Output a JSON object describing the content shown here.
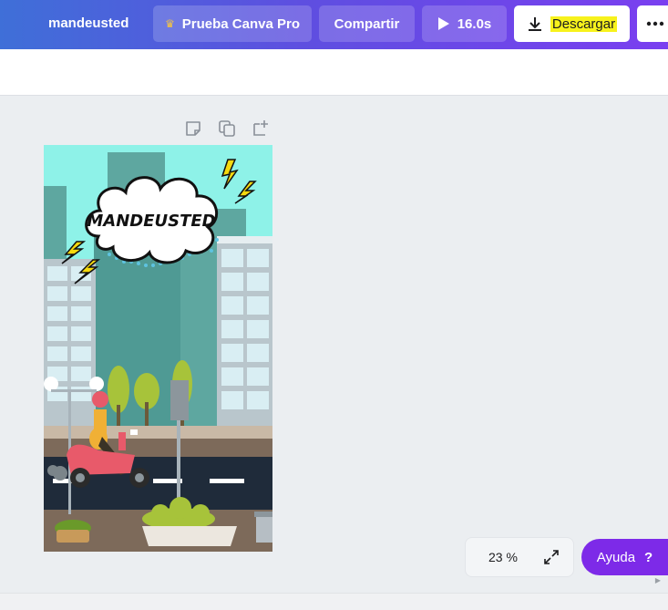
{
  "topbar": {
    "user_name": "mandeusted",
    "pro_trial_label": "Prueba Canva Pro",
    "share_label": "Compartir",
    "play_duration": "16.0s",
    "download_label": "Descargar",
    "more_icon": "more-dots-icon",
    "crown_icon": "crown-icon"
  },
  "page_tools": {
    "icons": [
      "note-icon",
      "duplicate-page-icon",
      "add-page-icon"
    ]
  },
  "design": {
    "title_text": "MANDEUSTED"
  },
  "bottom": {
    "zoom": "23 %",
    "help_label": "Ayuda",
    "help_icon": "?"
  },
  "colors": {
    "accent_purple": "#7d2ae8",
    "highlight_yellow": "#f7f21c",
    "canvas_sky": "#8ef2e8"
  }
}
